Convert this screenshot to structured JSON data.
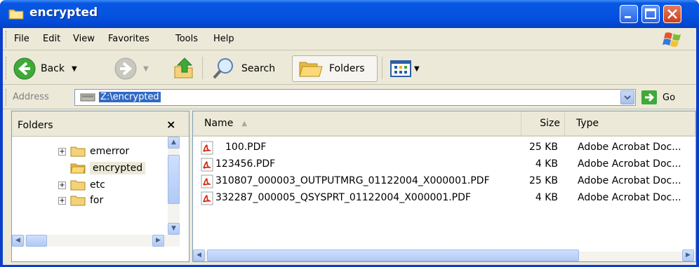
{
  "window": {
    "title": "encrypted"
  },
  "menu": [
    "File",
    "Edit",
    "View",
    "Favorites",
    "Tools",
    "Help"
  ],
  "toolbar": {
    "back_label": "Back",
    "search_label": "Search",
    "folders_label": "Folders"
  },
  "address": {
    "label": "Address",
    "value": "Z:\\encrypted",
    "go_label": "Go"
  },
  "folders_pane": {
    "title": "Folders",
    "close": "×",
    "items": [
      {
        "label": "emerror",
        "expandable": true,
        "selected": false
      },
      {
        "label": "encrypted",
        "expandable": false,
        "selected": true
      },
      {
        "label": "etc",
        "expandable": true,
        "selected": false
      },
      {
        "label": "for",
        "expandable": true,
        "selected": false
      }
    ]
  },
  "files": {
    "columns": {
      "name": "Name",
      "size": "Size",
      "type": "Type"
    },
    "rows": [
      {
        "name": "100.PDF",
        "size": "25 KB",
        "type": "Adobe Acrobat Doc..."
      },
      {
        "name": "123456.PDF",
        "size": "4 KB",
        "type": "Adobe Acrobat Doc..."
      },
      {
        "name": "310807_000003_OUTPUTMRG_01122004_X000001.PDF",
        "size": "25 KB",
        "type": "Adobe Acrobat Doc..."
      },
      {
        "name": "332287_000005_QSYSPRT_01122004_X000001.PDF",
        "size": "4 KB",
        "type": "Adobe Acrobat Doc..."
      }
    ]
  },
  "colors": {
    "title_blue": "#0554e0",
    "selection": "#316ac5",
    "pdf_red": "#d81e05"
  },
  "icons": [
    "folder-icon",
    "back-icon",
    "forward-icon",
    "up-folder-icon",
    "search-icon",
    "folders-icon",
    "views-icon",
    "go-icon",
    "pdf-icon",
    "windows-logo-icon"
  ]
}
